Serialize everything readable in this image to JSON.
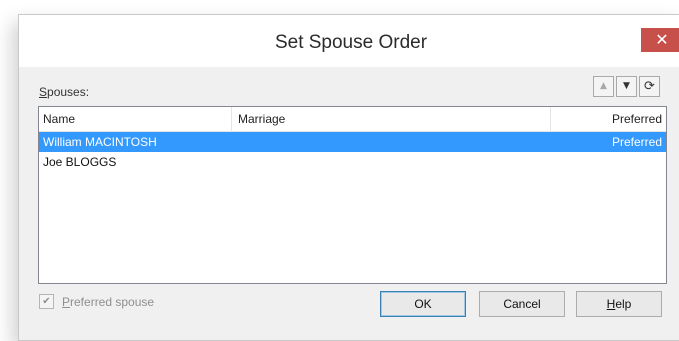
{
  "dialog": {
    "title": "Set Spouse Order",
    "close_glyph": "✕"
  },
  "spouses_label": {
    "accel": "S",
    "rest": "pouses:"
  },
  "order_buttons": {
    "up_glyph": "▲",
    "down_glyph": "▼",
    "refresh_glyph": "⟳",
    "icons": [
      "move-up-icon",
      "move-down-icon",
      "refresh-icon"
    ]
  },
  "list": {
    "columns": {
      "name": "Name",
      "marriage": "Marriage",
      "preferred": "Preferred"
    },
    "rows": [
      {
        "name": "William MACINTOSH",
        "marriage": "",
        "preferred": "Preferred",
        "selected": true
      },
      {
        "name": "Joe BLOGGS",
        "marriage": "",
        "preferred": "",
        "selected": false
      }
    ]
  },
  "preferred_spouse": {
    "accel": "P",
    "rest": "referred spouse",
    "checked": true,
    "check_glyph": "✔",
    "enabled": false
  },
  "buttons": {
    "ok": "OK",
    "cancel": "Cancel",
    "help_accel": "H",
    "help_rest": "elp"
  },
  "colors": {
    "selection": "#3399ff",
    "close_button": "#c7504b",
    "dialog_bg": "#f0f0f0"
  }
}
